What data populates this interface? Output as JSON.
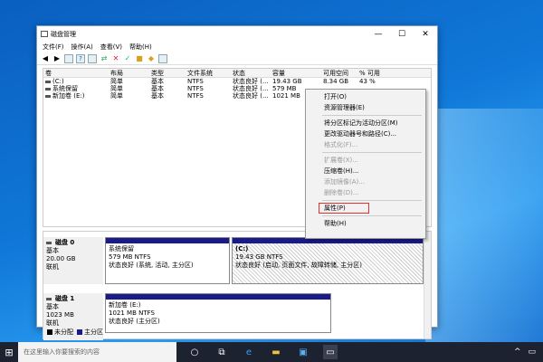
{
  "window": {
    "title": "磁盘管理",
    "controls": {
      "min": "—",
      "max": "☐",
      "close": "✕"
    }
  },
  "menu": [
    "文件(F)",
    "操作(A)",
    "查看(V)",
    "帮助(H)"
  ],
  "toolbar_icons": [
    "back-icon",
    "forward-icon",
    "list-icon",
    "help-icon",
    "list-view-icon",
    "connect-icon",
    "delete-icon",
    "properties-icon",
    "folder-icon",
    "rescan-icon",
    "disk-icon"
  ],
  "volumes": {
    "headers": [
      "卷",
      "布局",
      "类型",
      "文件系统",
      "状态",
      "容量",
      "可用空间",
      "% 可用"
    ],
    "rows": [
      [
        "(C:)",
        "简单",
        "基本",
        "NTFS",
        "状态良好 (...",
        "19.43 GB",
        "8.34 GB",
        "43 %"
      ],
      [
        "系统保留",
        "简单",
        "基本",
        "NTFS",
        "状态良好 (...",
        "579 MB",
        "",
        ""
      ],
      [
        "新加卷 (E:)",
        "简单",
        "基本",
        "NTFS",
        "状态良好 (...",
        "1021 MB",
        "",
        ""
      ]
    ]
  },
  "disks": [
    {
      "name": "磁盘 0",
      "type": "基本",
      "size": "20.00 GB",
      "status": "联机",
      "partitions": [
        {
          "name": "系统保留",
          "info": "579 MB NTFS",
          "status": "状态良好 (系统, 活动, 主分区)"
        },
        {
          "name": "(C:)",
          "info": "19.43 GB NTFS",
          "status": "状态良好 (启动, 页面文件, 故障转储, 主分区)"
        }
      ]
    },
    {
      "name": "磁盘 1",
      "type": "基本",
      "size": "1023 MB",
      "status": "联机",
      "partitions": [
        {
          "name": "新加卷 (E:)",
          "info": "1021 MB NTFS",
          "status": "状态良好 (主分区)"
        }
      ]
    }
  ],
  "legend": {
    "unallocated": "未分配",
    "primary": "主分区"
  },
  "context_menu": {
    "items": [
      {
        "label": "打开(O)",
        "enabled": true
      },
      {
        "label": "资源管理器(E)",
        "enabled": true
      },
      {
        "sep": true
      },
      {
        "label": "将分区标记为活动分区(M)",
        "enabled": true
      },
      {
        "label": "更改驱动器号和路径(C)...",
        "enabled": true
      },
      {
        "label": "格式化(F)...",
        "enabled": false
      },
      {
        "sep": true
      },
      {
        "label": "扩展卷(X)...",
        "enabled": false
      },
      {
        "label": "压缩卷(H)...",
        "enabled": true
      },
      {
        "label": "添加镜像(A)...",
        "enabled": false
      },
      {
        "label": "删除卷(D)...",
        "enabled": false
      },
      {
        "sep": true
      },
      {
        "label": "属性(P)",
        "enabled": true,
        "highlighted": true
      },
      {
        "sep": true
      },
      {
        "label": "帮助(H)",
        "enabled": true
      }
    ]
  },
  "taskbar": {
    "search_placeholder": "在这里输入你要搜索的内容",
    "icons": [
      "cortana-icon",
      "task-view-icon",
      "edge-icon",
      "file-explorer-icon",
      "store-icon",
      "disk-management-icon"
    ]
  },
  "colors": {
    "primary_partition": "#1a1a8a",
    "highlight_border": "#e03030",
    "taskbar": "#1c2230"
  }
}
